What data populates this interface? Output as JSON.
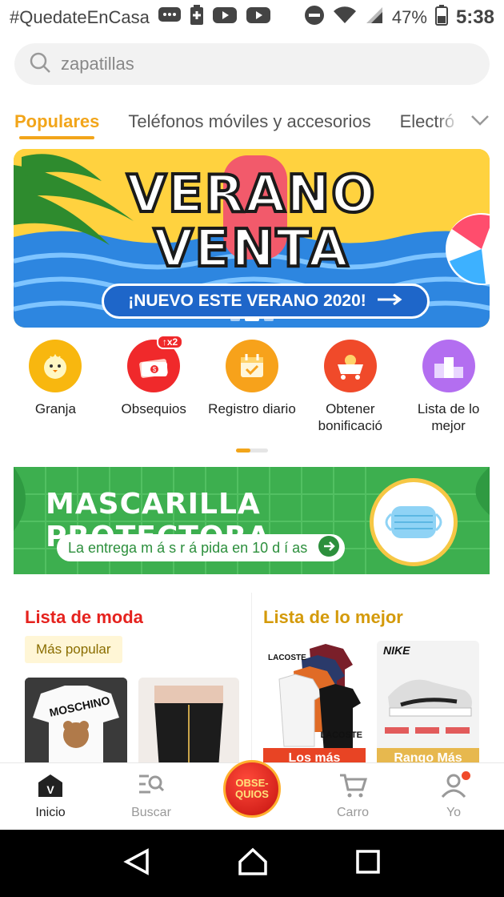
{
  "status_bar": {
    "carrier_text": "#QuedateEnCasa",
    "battery": "47%",
    "time": "5:38",
    "icons": [
      "message-icon",
      "battery-saver-icon",
      "youtube-icon",
      "youtube-icon",
      "do-not-disturb-icon",
      "wifi-icon",
      "signal-icon",
      "battery-icon"
    ]
  },
  "search": {
    "placeholder": "zapatillas",
    "icon": "search-icon"
  },
  "tabs": [
    {
      "label": "Populares",
      "active": true
    },
    {
      "label": "Teléfonos móviles y accesorios",
      "active": false
    },
    {
      "label": "Electró",
      "active": false
    }
  ],
  "banner": {
    "line1": "VERANO",
    "line2": "VENTA",
    "cta": "¡NUEVO ESTE VERANO 2020!",
    "accent": "#ffd23f"
  },
  "quick_actions": [
    {
      "label": "Granja",
      "icon": "chick-icon",
      "color": "#f8b70f"
    },
    {
      "label": "Obsequios",
      "icon": "money-gift-icon",
      "color": "#f0292b",
      "badge": "x2"
    },
    {
      "label": "Registro diario",
      "icon": "calendar-check-icon",
      "color": "#f7a21b"
    },
    {
      "label": "Obtener bonificació",
      "icon": "cart-coins-icon",
      "color": "#f04a2a"
    },
    {
      "label": "Lista de lo mejor",
      "icon": "podium-icon",
      "color": "#b36ef0"
    }
  ],
  "promo": {
    "title": "MASCARILLA PROTECTORA",
    "subtitle": "La entrega m á s r á pida en 10 d í as",
    "color": "#3daf4f"
  },
  "lists": {
    "left": {
      "title": "Lista de moda",
      "title_color": "#e5221e",
      "tag": "Más popular",
      "thumb1_text": "MOSCHINO"
    },
    "right": {
      "title": "Lista de lo mejor",
      "title_color": "#d49a0a",
      "thumb1_brand": "LACOSTE",
      "thumb1_brand2": "LACOSTE",
      "thumb1_caption": "Los más",
      "thumb2_brand": "NIKE",
      "thumb2_caption": "Rango Más"
    }
  },
  "bottom_nav": [
    {
      "label": "Inicio",
      "icon": "home-icon",
      "active": true
    },
    {
      "label": "Buscar",
      "icon": "browse-icon",
      "active": false
    },
    {
      "label": "OBSE-QUIOS",
      "icon": "gift-icon",
      "center": true
    },
    {
      "label": "Carro",
      "icon": "cart-icon",
      "active": false
    },
    {
      "label": "Yo",
      "icon": "profile-icon",
      "active": false
    }
  ],
  "android_nav": [
    "back-icon",
    "home-circle-icon",
    "recents-icon"
  ]
}
